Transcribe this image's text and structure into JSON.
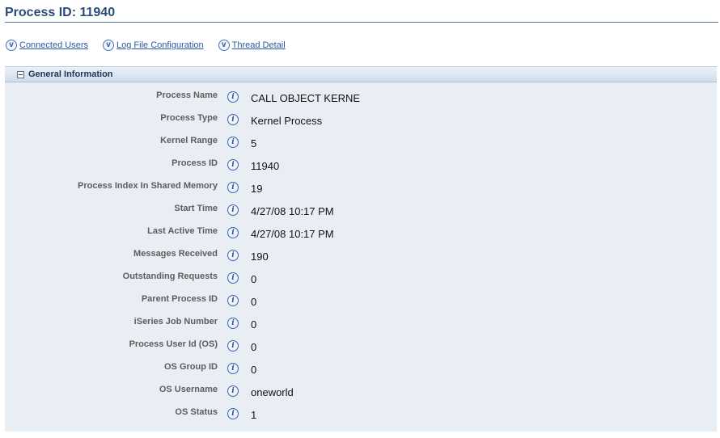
{
  "page": {
    "title": "Process ID: 11940"
  },
  "links": [
    {
      "icon": "v-circle-icon",
      "label": "Connected Users"
    },
    {
      "icon": "v-circle-icon",
      "label": "Log File Configuration"
    },
    {
      "icon": "v-circle-icon",
      "label": "Thread Detail"
    }
  ],
  "section": {
    "title": "General Information",
    "collapse_icon": "minus-box-icon",
    "fields": [
      {
        "label": "Process Name",
        "value": "CALL OBJECT KERNE"
      },
      {
        "label": "Process Type",
        "value": "Kernel Process"
      },
      {
        "label": "Kernel Range",
        "value": "5"
      },
      {
        "label": "Process ID",
        "value": "11940"
      },
      {
        "label": "Process Index In Shared Memory",
        "value": "19"
      },
      {
        "label": "Start Time",
        "value": "4/27/08 10:17 PM"
      },
      {
        "label": "Last Active Time",
        "value": "4/27/08 10:17 PM"
      },
      {
        "label": "Messages Received",
        "value": "190"
      },
      {
        "label": "Outstanding Requests",
        "value": "0"
      },
      {
        "label": "Parent Process ID",
        "value": "0"
      },
      {
        "label": "iSeries Job Number",
        "value": "0"
      },
      {
        "label": "Process User Id (OS)",
        "value": "0"
      },
      {
        "label": "OS Group ID",
        "value": "0"
      },
      {
        "label": "OS Username",
        "value": "oneworld"
      },
      {
        "label": "OS Status",
        "value": "1"
      }
    ]
  },
  "colors": {
    "title": "#2b4b7b",
    "link": "#2d58a6",
    "section_body": "#e8eef4",
    "label": "#5d5d5d"
  }
}
